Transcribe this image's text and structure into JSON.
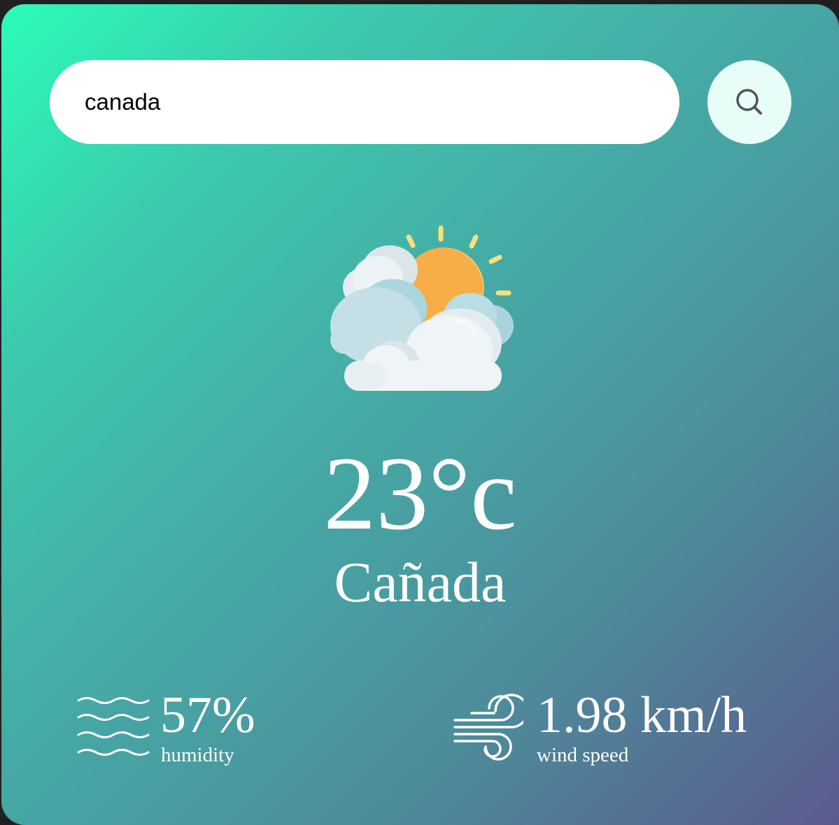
{
  "search": {
    "value": "canada",
    "button_icon": "search-icon"
  },
  "weather": {
    "icon": "partly-cloudy-icon",
    "temperature": "23°c",
    "city": "Cañada"
  },
  "details": {
    "humidity": {
      "icon": "humidity-icon",
      "value": "57%",
      "label": "humidity"
    },
    "wind": {
      "icon": "wind-icon",
      "value": "1.98 km/h",
      "label": "wind speed"
    }
  },
  "colors": {
    "gradient_start": "#2bfcb9",
    "gradient_end": "#5b5b8e",
    "text": "#ffffff",
    "search_button_bg": "#e8fcf8"
  }
}
